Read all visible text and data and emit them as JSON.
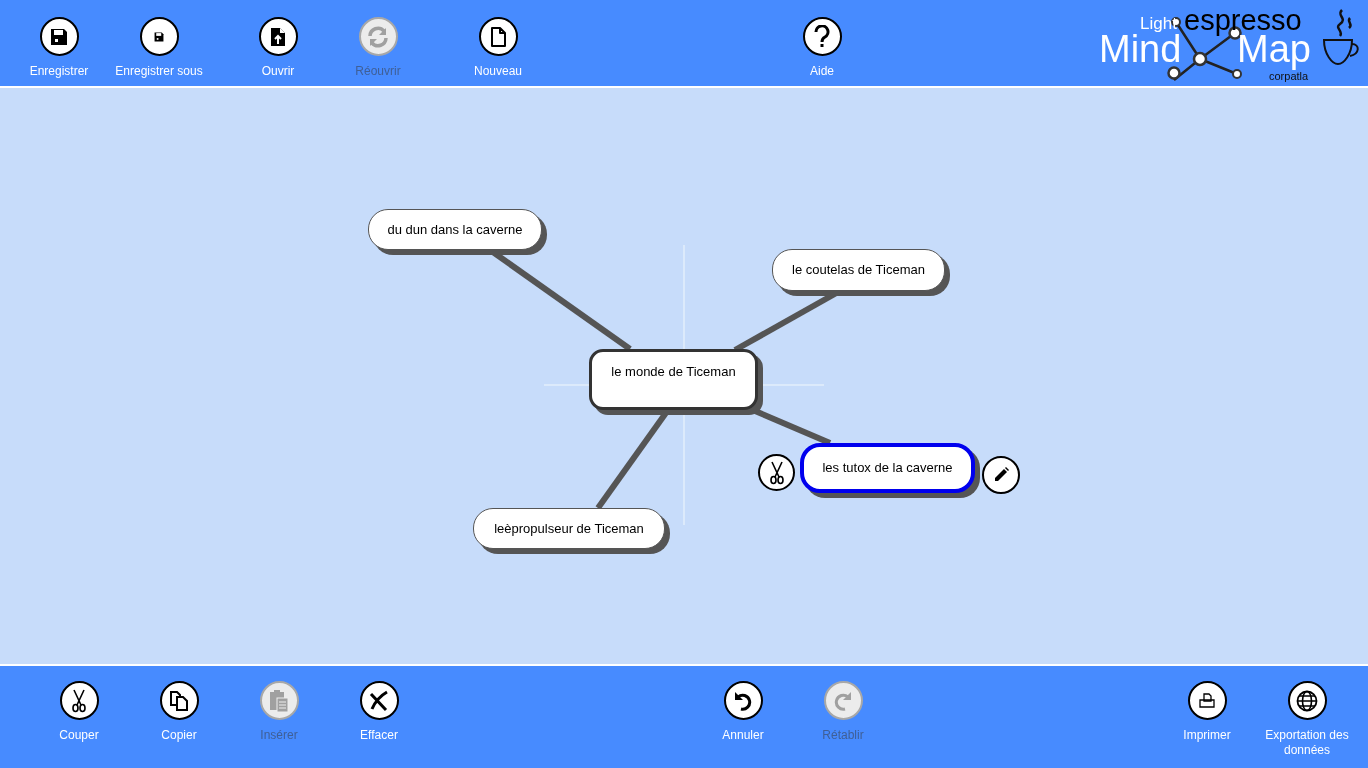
{
  "top_toolbar": [
    {
      "label": "Enregistrer",
      "kind": "save",
      "disabled": false
    },
    {
      "label": "Enregistrer sous",
      "kind": "save-small",
      "disabled": false
    },
    {
      "label": "Ouvrir",
      "kind": "open",
      "disabled": false
    },
    {
      "label": "Réouvrir",
      "kind": "refresh",
      "disabled": true
    },
    {
      "label": "Nouveau",
      "kind": "new",
      "disabled": false
    },
    {
      "label": "Aide",
      "kind": "help",
      "disabled": false
    }
  ],
  "logo": {
    "light": "Light",
    "mind": "Mind",
    "map": "Map",
    "espresso": "espresso",
    "author": "corpatla"
  },
  "mind_map": {
    "nodes": [
      {
        "kind": "child",
        "text": "du dun dans la caverne",
        "selected": false
      },
      {
        "kind": "child",
        "text": "le coutelas de Ticeman",
        "selected": false
      },
      {
        "kind": "root",
        "text": "le monde de Ticeman",
        "selected": false
      },
      {
        "kind": "child",
        "text": "les tutox de la caverne",
        "selected": true
      },
      {
        "kind": "child",
        "text": "leèpropulseur de Ticeman",
        "selected": false
      }
    ]
  },
  "bottom_toolbar": [
    {
      "label": "Couper",
      "kind": "cut",
      "disabled": false
    },
    {
      "label": "Copier",
      "kind": "copy",
      "disabled": false
    },
    {
      "label": "Insérer",
      "kind": "paste",
      "disabled": true
    },
    {
      "label": "Effacer",
      "kind": "erase",
      "disabled": false
    },
    {
      "label": "Annuler",
      "kind": "undo",
      "disabled": false
    },
    {
      "label": "Rétablir",
      "kind": "redo",
      "disabled": true
    },
    {
      "label": "Imprimer",
      "kind": "print",
      "disabled": false
    },
    {
      "label": "Exportation des données",
      "kind": "globe",
      "disabled": false
    }
  ]
}
